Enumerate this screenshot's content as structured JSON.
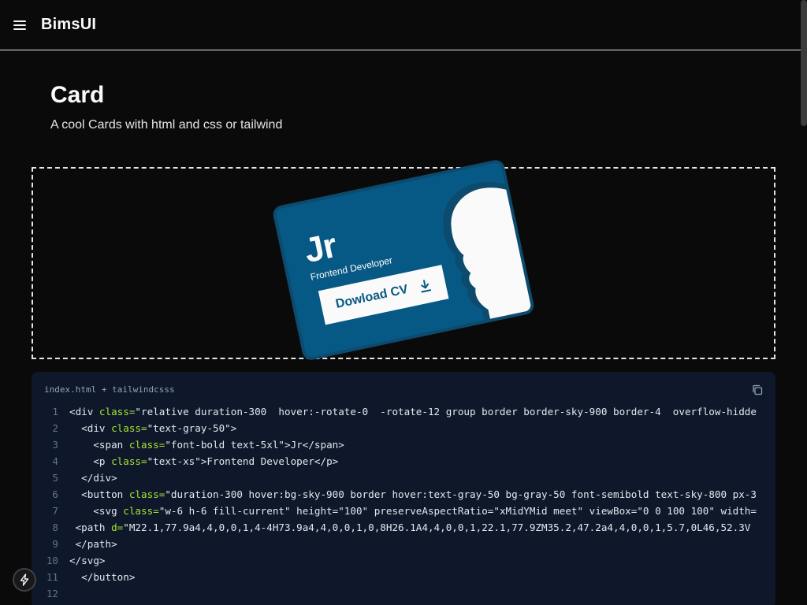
{
  "header": {
    "brand": "BimsUI",
    "menu_icon": "hamburger-menu-icon"
  },
  "page": {
    "title": "Card",
    "subtitle": "A cool Cards with html and css or tailwind"
  },
  "card": {
    "initials": "Jr",
    "role": "Frontend Developer",
    "button_label": "Dowload CV",
    "button_icon": "download-icon",
    "colors": {
      "background": "#075985",
      "border": "#0c4a6e",
      "button_bg": "#fafafa",
      "text": "#fafafa"
    }
  },
  "code": {
    "tab_label": "index.html + tailwindcsss",
    "copy_icon": "copy-icon",
    "lines": [
      {
        "n": "1",
        "indent": "",
        "tag": "<div ",
        "attr": "class=",
        "str": "\"relative duration-300  hover:-rotate-0  -rotate-12 group border border-sky-900 border-4  overflow-hidde",
        "end": ""
      },
      {
        "n": "2",
        "indent": "  ",
        "tag": "<div ",
        "attr": "class=",
        "str": "\"text-gray-50\"",
        "end": ">"
      },
      {
        "n": "3",
        "indent": "    ",
        "tag": "<span ",
        "attr": "class=",
        "str": "\"font-bold text-5xl\"",
        "end": ">Jr</span>"
      },
      {
        "n": "4",
        "indent": "    ",
        "tag": "<p ",
        "attr": "class=",
        "str": "\"text-xs\"",
        "end": ">Frontend Developer</p>"
      },
      {
        "n": "5",
        "indent": "  ",
        "tag": "</div>",
        "attr": "",
        "str": "",
        "end": ""
      },
      {
        "n": "6",
        "indent": "  ",
        "tag": "<button ",
        "attr": "class=",
        "str": "\"duration-300 hover:bg-sky-900 border hover:text-gray-50 bg-gray-50 font-semibold text-sky-800 px-3",
        "end": ""
      },
      {
        "n": "7",
        "indent": "    ",
        "tag": "<svg ",
        "attr": "class=",
        "str": "\"w-6 h-6 fill-current\" height=\"100\" preserveAspectRatio=\"xMidYMid meet\" viewBox=\"0 0 100 100\" width=",
        "end": ""
      },
      {
        "n": "8",
        "indent": " ",
        "tag": "<path ",
        "attr": "d=",
        "str": "\"M22.1,77.9a4,4,0,0,1,4-4H73.9a4,4,0,0,1,0,8H26.1A4,4,0,0,1,22.1,77.9ZM35.2,47.2a4,4,0,0,1,5.7,0L46,52.3V",
        "end": ""
      },
      {
        "n": "9",
        "indent": " ",
        "tag": "</path>",
        "attr": "",
        "str": "",
        "end": ""
      },
      {
        "n": "10",
        "indent": "",
        "tag": "</svg>",
        "attr": "",
        "str": "",
        "end": ""
      },
      {
        "n": "11",
        "indent": "  ",
        "tag": "</button>",
        "attr": "",
        "str": "",
        "end": ""
      },
      {
        "n": "12",
        "indent": "",
        "tag": "",
        "attr": "",
        "str": "",
        "end": ""
      }
    ]
  },
  "floating": {
    "bolt_icon": "lightning-bolt-icon"
  }
}
